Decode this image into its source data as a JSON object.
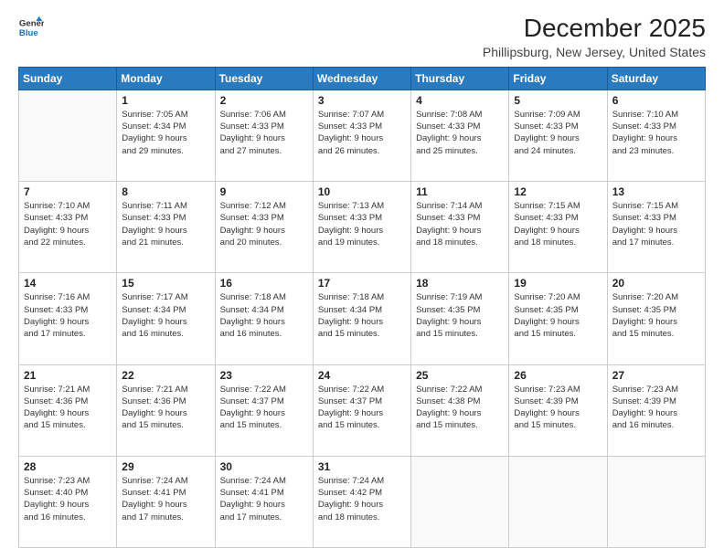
{
  "logo": {
    "line1": "General",
    "line2": "Blue"
  },
  "title": "December 2025",
  "subtitle": "Phillipsburg, New Jersey, United States",
  "header": {
    "days": [
      "Sunday",
      "Monday",
      "Tuesday",
      "Wednesday",
      "Thursday",
      "Friday",
      "Saturday"
    ]
  },
  "weeks": [
    [
      {
        "day": "",
        "info": ""
      },
      {
        "day": "1",
        "info": "Sunrise: 7:05 AM\nSunset: 4:34 PM\nDaylight: 9 hours\nand 29 minutes."
      },
      {
        "day": "2",
        "info": "Sunrise: 7:06 AM\nSunset: 4:33 PM\nDaylight: 9 hours\nand 27 minutes."
      },
      {
        "day": "3",
        "info": "Sunrise: 7:07 AM\nSunset: 4:33 PM\nDaylight: 9 hours\nand 26 minutes."
      },
      {
        "day": "4",
        "info": "Sunrise: 7:08 AM\nSunset: 4:33 PM\nDaylight: 9 hours\nand 25 minutes."
      },
      {
        "day": "5",
        "info": "Sunrise: 7:09 AM\nSunset: 4:33 PM\nDaylight: 9 hours\nand 24 minutes."
      },
      {
        "day": "6",
        "info": "Sunrise: 7:10 AM\nSunset: 4:33 PM\nDaylight: 9 hours\nand 23 minutes."
      }
    ],
    [
      {
        "day": "7",
        "info": "Sunrise: 7:10 AM\nSunset: 4:33 PM\nDaylight: 9 hours\nand 22 minutes."
      },
      {
        "day": "8",
        "info": "Sunrise: 7:11 AM\nSunset: 4:33 PM\nDaylight: 9 hours\nand 21 minutes."
      },
      {
        "day": "9",
        "info": "Sunrise: 7:12 AM\nSunset: 4:33 PM\nDaylight: 9 hours\nand 20 minutes."
      },
      {
        "day": "10",
        "info": "Sunrise: 7:13 AM\nSunset: 4:33 PM\nDaylight: 9 hours\nand 19 minutes."
      },
      {
        "day": "11",
        "info": "Sunrise: 7:14 AM\nSunset: 4:33 PM\nDaylight: 9 hours\nand 18 minutes."
      },
      {
        "day": "12",
        "info": "Sunrise: 7:15 AM\nSunset: 4:33 PM\nDaylight: 9 hours\nand 18 minutes."
      },
      {
        "day": "13",
        "info": "Sunrise: 7:15 AM\nSunset: 4:33 PM\nDaylight: 9 hours\nand 17 minutes."
      }
    ],
    [
      {
        "day": "14",
        "info": "Sunrise: 7:16 AM\nSunset: 4:33 PM\nDaylight: 9 hours\nand 17 minutes."
      },
      {
        "day": "15",
        "info": "Sunrise: 7:17 AM\nSunset: 4:34 PM\nDaylight: 9 hours\nand 16 minutes."
      },
      {
        "day": "16",
        "info": "Sunrise: 7:18 AM\nSunset: 4:34 PM\nDaylight: 9 hours\nand 16 minutes."
      },
      {
        "day": "17",
        "info": "Sunrise: 7:18 AM\nSunset: 4:34 PM\nDaylight: 9 hours\nand 15 minutes."
      },
      {
        "day": "18",
        "info": "Sunrise: 7:19 AM\nSunset: 4:35 PM\nDaylight: 9 hours\nand 15 minutes."
      },
      {
        "day": "19",
        "info": "Sunrise: 7:20 AM\nSunset: 4:35 PM\nDaylight: 9 hours\nand 15 minutes."
      },
      {
        "day": "20",
        "info": "Sunrise: 7:20 AM\nSunset: 4:35 PM\nDaylight: 9 hours\nand 15 minutes."
      }
    ],
    [
      {
        "day": "21",
        "info": "Sunrise: 7:21 AM\nSunset: 4:36 PM\nDaylight: 9 hours\nand 15 minutes."
      },
      {
        "day": "22",
        "info": "Sunrise: 7:21 AM\nSunset: 4:36 PM\nDaylight: 9 hours\nand 15 minutes."
      },
      {
        "day": "23",
        "info": "Sunrise: 7:22 AM\nSunset: 4:37 PM\nDaylight: 9 hours\nand 15 minutes."
      },
      {
        "day": "24",
        "info": "Sunrise: 7:22 AM\nSunset: 4:37 PM\nDaylight: 9 hours\nand 15 minutes."
      },
      {
        "day": "25",
        "info": "Sunrise: 7:22 AM\nSunset: 4:38 PM\nDaylight: 9 hours\nand 15 minutes."
      },
      {
        "day": "26",
        "info": "Sunrise: 7:23 AM\nSunset: 4:39 PM\nDaylight: 9 hours\nand 15 minutes."
      },
      {
        "day": "27",
        "info": "Sunrise: 7:23 AM\nSunset: 4:39 PM\nDaylight: 9 hours\nand 16 minutes."
      }
    ],
    [
      {
        "day": "28",
        "info": "Sunrise: 7:23 AM\nSunset: 4:40 PM\nDaylight: 9 hours\nand 16 minutes."
      },
      {
        "day": "29",
        "info": "Sunrise: 7:24 AM\nSunset: 4:41 PM\nDaylight: 9 hours\nand 17 minutes."
      },
      {
        "day": "30",
        "info": "Sunrise: 7:24 AM\nSunset: 4:41 PM\nDaylight: 9 hours\nand 17 minutes."
      },
      {
        "day": "31",
        "info": "Sunrise: 7:24 AM\nSunset: 4:42 PM\nDaylight: 9 hours\nand 18 minutes."
      },
      {
        "day": "",
        "info": ""
      },
      {
        "day": "",
        "info": ""
      },
      {
        "day": "",
        "info": ""
      }
    ]
  ]
}
